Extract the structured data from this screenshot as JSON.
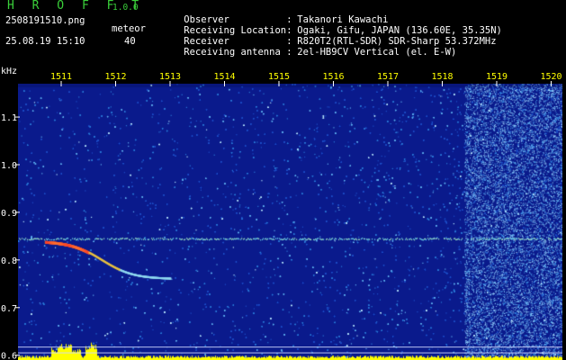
{
  "header": {
    "app_title": "H R O F F T",
    "app_version": "1.0.0",
    "file_name": "2508191510.png",
    "date_time": "25.08.19 15:10",
    "meteor_label": "meteor",
    "meteor_count": "40",
    "info": [
      {
        "key": "Observer",
        "sep": ":",
        "value": "Takanori Kawachi"
      },
      {
        "key": "Receiving Location",
        "sep": ":",
        "value": "Ogaki, Gifu, JAPAN (136.60E, 35.35N)"
      },
      {
        "key": "Receiver",
        "sep": ":",
        "value": "R820T2(RTL-SDR) SDR-Sharp 53.372MHz"
      },
      {
        "key": "Receiving antenna",
        "sep": ":",
        "value": "2el-HB9CV Vertical (el. E-W)"
      }
    ]
  },
  "chart_data": {
    "type": "heatmap",
    "ylabel": "kHz",
    "x_ticks": [
      "1511",
      "1512",
      "1513",
      "1514",
      "1515",
      "1516",
      "1517",
      "1518",
      "1519",
      "1520"
    ],
    "y_ticks": [
      {
        "label": "1.1",
        "value": 1.1
      },
      {
        "label": "1.0",
        "value": 1.0
      },
      {
        "label": "0.9",
        "value": 0.9
      },
      {
        "label": "0.8",
        "value": 0.8
      },
      {
        "label": "0.7",
        "value": 0.7
      },
      {
        "label": "0.6",
        "value": 0.6
      }
    ],
    "ylim": [
      0.59,
      1.17
    ],
    "carrier_khz": 0.845,
    "meteor_echo": {
      "start_minute": 1510.7,
      "end_minute": 1513.0,
      "start_khz": 0.84,
      "end_khz": 0.76
    },
    "colors": {
      "background": "#0a1a8c",
      "noise": "#2a7ad8",
      "hot": "#ff2020",
      "bars": "#ffff00",
      "text": "#ffff00",
      "label": "#ffffff"
    }
  }
}
